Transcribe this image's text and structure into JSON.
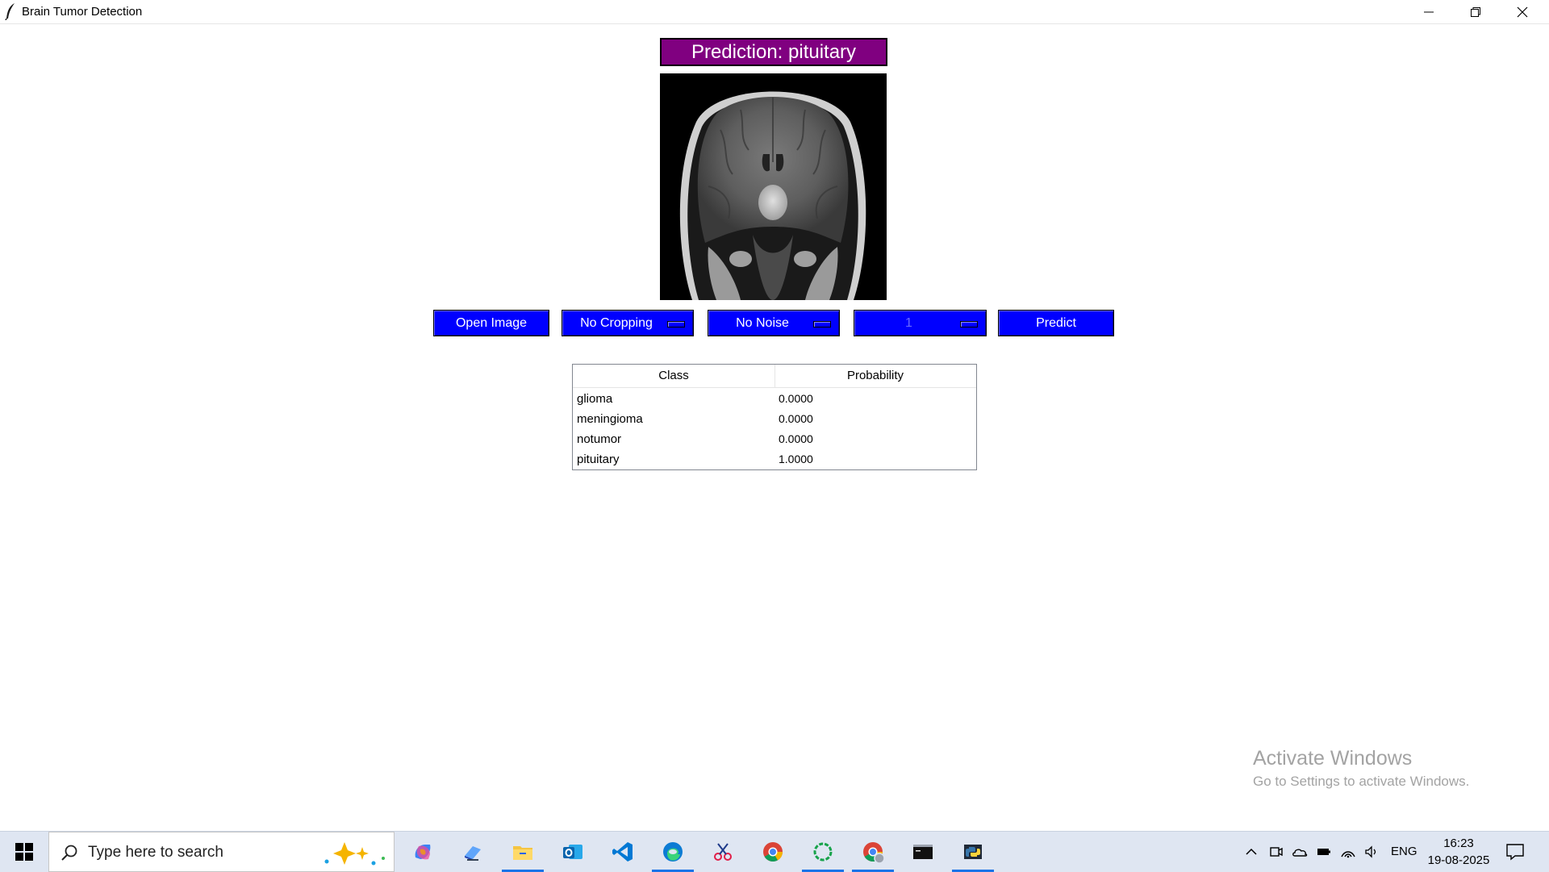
{
  "window": {
    "title": "Brain Tumor Detection",
    "icons": {
      "app": "feather-icon",
      "minimize": "minimize-icon",
      "maximize": "restore-icon",
      "close": "close-icon"
    }
  },
  "prediction": {
    "label": "Prediction: pituitary",
    "color": "#800080"
  },
  "image": {
    "subject": "mri-brain-scan"
  },
  "controls": {
    "open_image": "Open Image",
    "crop_select": "No Cropping",
    "noise_select": "No Noise",
    "count_select": "1",
    "predict": "Predict",
    "accent": "#0000ff"
  },
  "results": {
    "headers": [
      "Class",
      "Probability"
    ],
    "rows": [
      {
        "class": "glioma",
        "probability": "0.0000"
      },
      {
        "class": "meningioma",
        "probability": "0.0000"
      },
      {
        "class": "notumor",
        "probability": "0.0000"
      },
      {
        "class": "pituitary",
        "probability": "1.0000"
      }
    ]
  },
  "watermark": {
    "title": "Activate Windows",
    "subtitle": "Go to Settings to activate Windows."
  },
  "taskbar": {
    "search_placeholder": "Type here to search",
    "apps": [
      "copilot-icon",
      "desktop-icon",
      "file-explorer-icon",
      "outlook-icon",
      "vscode-icon",
      "edge-icon",
      "snipping-tool-icon",
      "chrome-icon",
      "loading-ring-icon",
      "chrome-profile-icon",
      "terminal-icon",
      "python-icon"
    ],
    "tray_icons": [
      "chevron-up-icon",
      "meet-icon",
      "onedrive-icon",
      "battery-icon",
      "wifi-icon",
      "volume-icon"
    ],
    "language": "ENG",
    "time": "16:23",
    "date": "19-08-2025"
  }
}
